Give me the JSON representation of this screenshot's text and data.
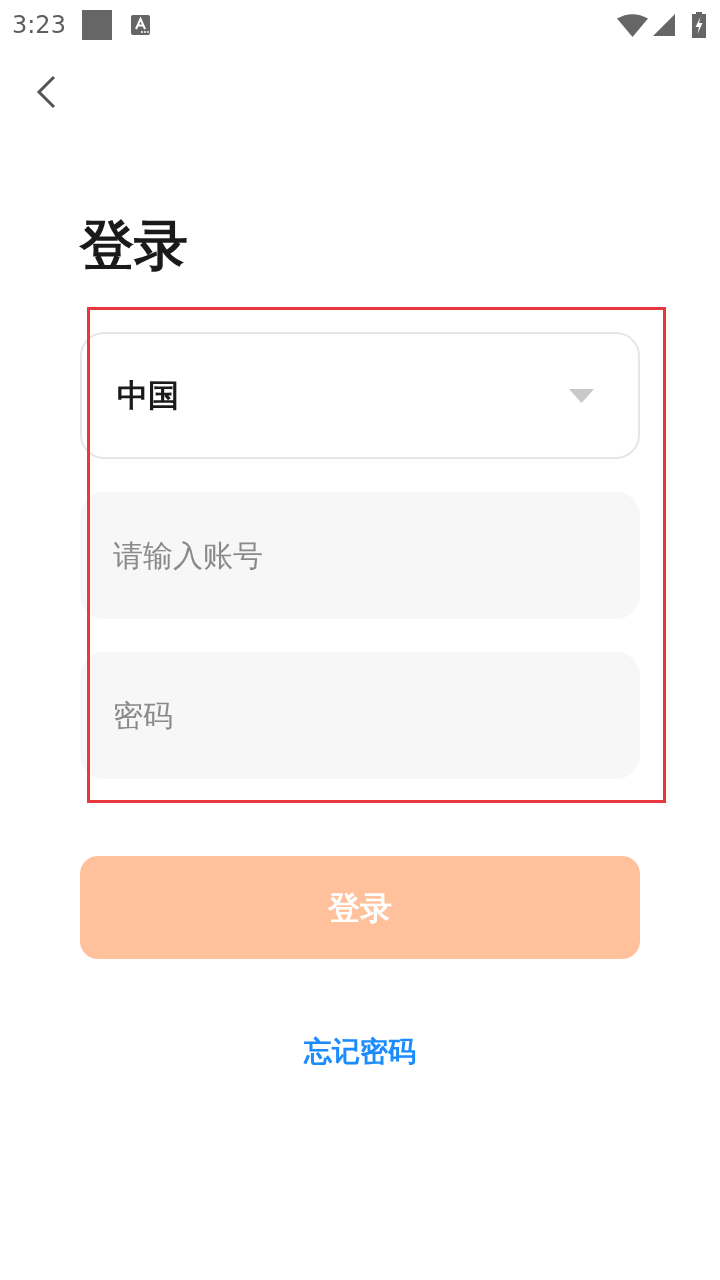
{
  "status_bar": {
    "time": "3:23"
  },
  "title": "登录",
  "form": {
    "country": {
      "value": "中国"
    },
    "account": {
      "placeholder": "请输入账号"
    },
    "password": {
      "placeholder": "密码"
    }
  },
  "login_button": {
    "label": "登录",
    "disabled": true
  },
  "forgot_link": {
    "label": "忘记密码"
  }
}
